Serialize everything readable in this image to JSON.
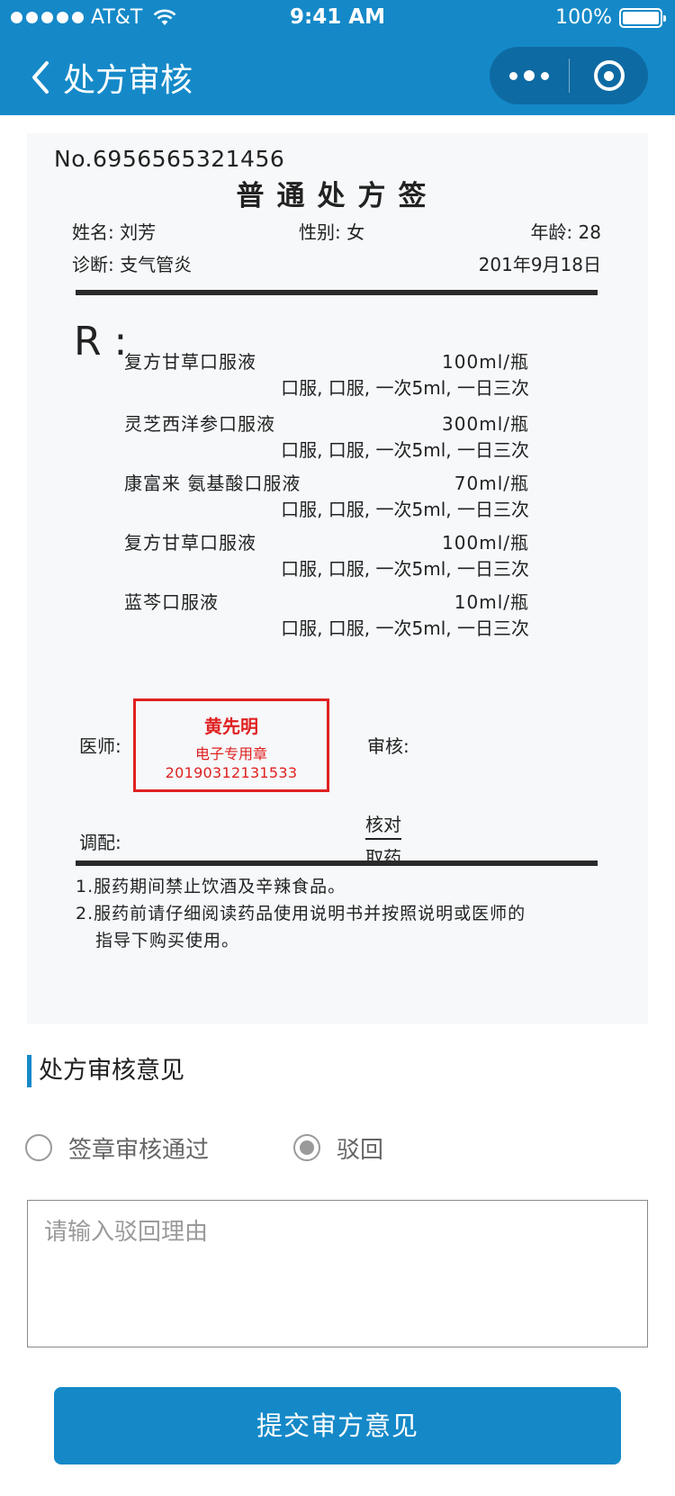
{
  "status_bar": {
    "carrier": "AT&T",
    "time": "9:41 AM",
    "battery": "100%"
  },
  "nav": {
    "title": "处方审核",
    "back_icon": "chevron-left-icon",
    "more_icon": "more-dots-icon",
    "close_icon": "target-circle-icon"
  },
  "prescription": {
    "number": "No.6956565321456",
    "title": "普通处方签",
    "patient": {
      "name_label": "姓名:",
      "name": "刘芳",
      "gender_label": "性别:",
      "gender": "女",
      "age_label": "年龄:",
      "age": "28",
      "diagnosis_label": "诊断:",
      "diagnosis": "支气管炎",
      "date": "201年9月18日"
    },
    "rx_symbol": "R :",
    "medicines": [
      {
        "name": "复方甘草口服液",
        "qty": "100ml/瓶",
        "usage": "口服, 口服, 一次5ml, 一日三次"
      },
      {
        "name": "灵芝西洋参口服液",
        "qty": "300ml/瓶",
        "usage": "口服, 口服, 一次5ml, 一日三次"
      },
      {
        "name": "康富来 氨基酸口服液",
        "qty": "70ml/瓶",
        "usage": "口服, 口服, 一次5ml, 一日三次"
      },
      {
        "name": "复方甘草口服液",
        "qty": "100ml/瓶",
        "usage": "口服, 口服, 一次5ml, 一日三次"
      },
      {
        "name": "蓝芩口服液",
        "qty": "10ml/瓶",
        "usage": "口服, 口服, 一次5ml, 一日三次"
      }
    ],
    "doctor_label": "医师:",
    "stamp": {
      "name": "黄先明",
      "type": "电子专用章",
      "code": "20190312131533",
      "color": "#e02121"
    },
    "review_label": "审核:",
    "dispense_label": "调配:",
    "check_label": "核对",
    "take_label": "取药",
    "notes": [
      "1.服药期间禁止饮酒及辛辣食品。",
      "2.服药前请仔细阅读药品使用说明书并按照说明或医师的",
      "指导下购买使用。"
    ]
  },
  "review": {
    "section_title": "处方审核意见",
    "options": [
      {
        "label": "签章审核通过",
        "selected": false
      },
      {
        "label": "驳回",
        "selected": true
      }
    ],
    "reason_placeholder": "请输入驳回理由",
    "submit_label": "提交审方意见"
  },
  "colors": {
    "primary": "#1589c8",
    "capsule": "#0e6aa3",
    "stamp": "#e02121",
    "card_bg": "#f6f8fa"
  }
}
